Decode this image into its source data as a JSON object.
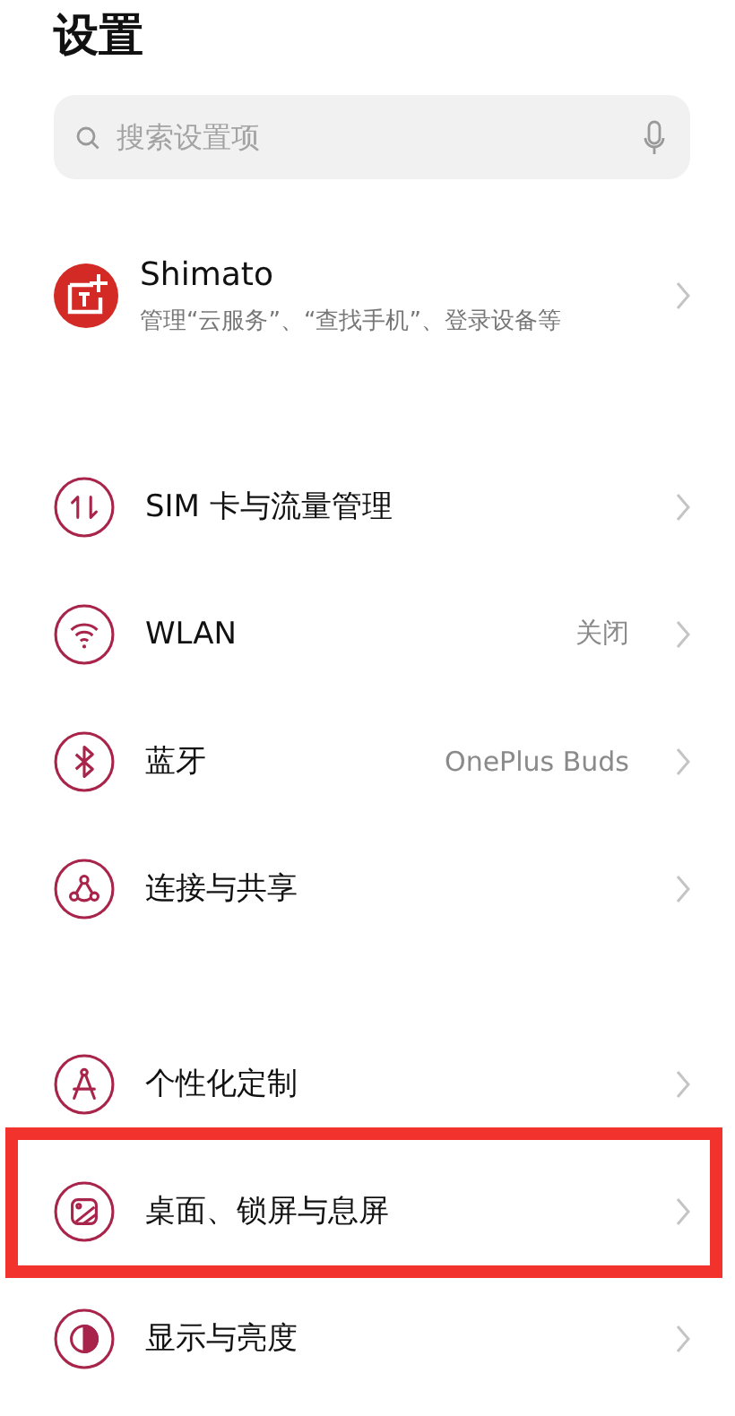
{
  "title": "设置",
  "search": {
    "placeholder": "搜索设置项"
  },
  "account": {
    "name": "Shimato",
    "subtitle": "管理“云服务”、“查找手机”、登录设备等"
  },
  "groups": [
    {
      "items": [
        {
          "kind": "sim",
          "label": "SIM 卡与流量管理",
          "highlighted": false
        },
        {
          "kind": "wlan",
          "label": "WLAN",
          "value": "关闭",
          "highlighted": false
        },
        {
          "kind": "bluetooth",
          "label": "蓝牙",
          "value": "OnePlus Buds",
          "highlighted": false
        },
        {
          "kind": "share",
          "label": "连接与共享",
          "highlighted": false
        }
      ]
    },
    {
      "items": [
        {
          "kind": "personalize",
          "label": "个性化定制",
          "highlighted": false
        },
        {
          "kind": "wallpaper",
          "label": "桌面、锁屏与息屏",
          "highlighted": true
        },
        {
          "kind": "display",
          "label": "显示与亮度",
          "highlighted": false
        }
      ]
    }
  ]
}
